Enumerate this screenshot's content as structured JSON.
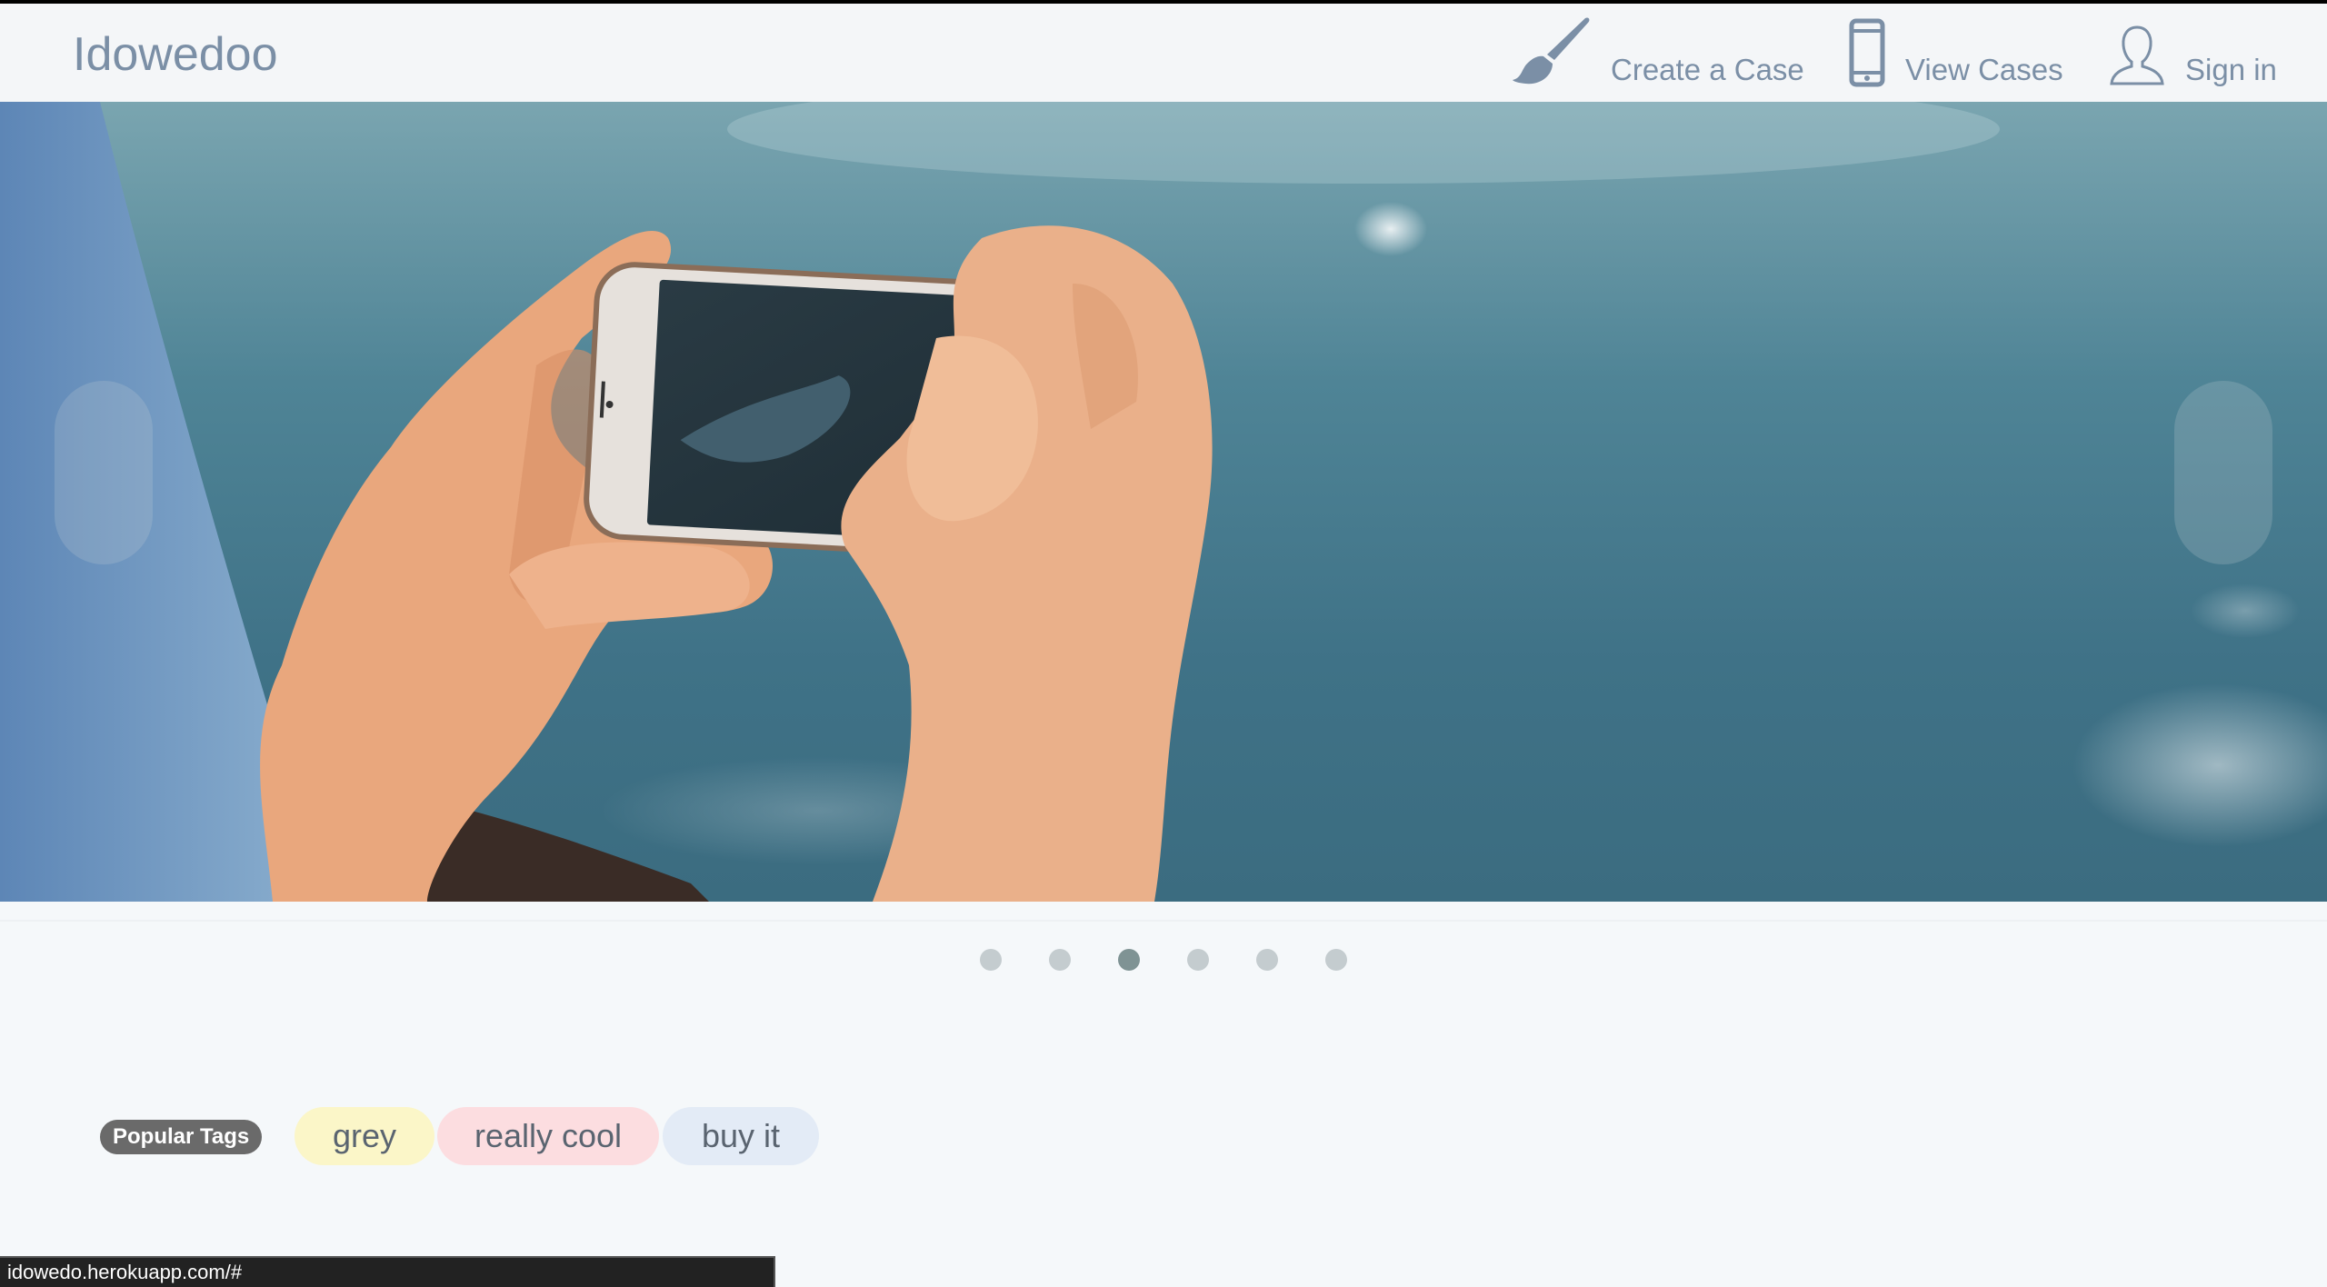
{
  "header": {
    "brand": "Idowedoo",
    "nav": [
      {
        "label": "Create a Case",
        "icon": "paintbrush-icon"
      },
      {
        "label": "View Cases",
        "icon": "phone-icon"
      },
      {
        "label": "Sign in",
        "icon": "user-icon"
      }
    ]
  },
  "carousel": {
    "slide_count": 6,
    "active_index": 2
  },
  "tags": {
    "label": "Popular Tags",
    "items": [
      {
        "label": "grey",
        "color": "#fbf6c8"
      },
      {
        "label": "really cool",
        "color": "#fcdde0"
      },
      {
        "label": "buy it",
        "color": "#e3ebf6"
      }
    ]
  },
  "status_bar": {
    "url": "idowedo.herokuapp.com/#"
  },
  "colors": {
    "nav_text": "#7b8fa6",
    "page_bg": "#f5f8fa",
    "active_dot": "#7f9394"
  }
}
